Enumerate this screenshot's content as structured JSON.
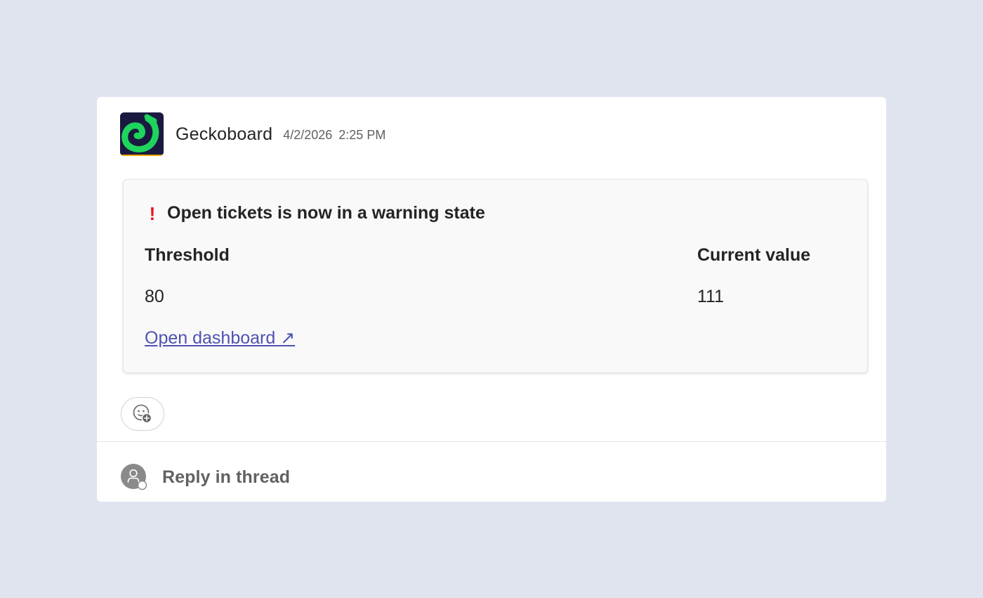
{
  "message": {
    "sender": "Geckoboard",
    "date": "4/2/2026",
    "time": "2:25 PM",
    "logo_icon": "geckoboard-logo"
  },
  "alert": {
    "icon": "exclamation-icon",
    "title": "Open tickets is now in a warning state",
    "columns": [
      {
        "label": "Threshold",
        "value": "80"
      },
      {
        "label": "Current value",
        "value": "111"
      }
    ],
    "link_label": "Open dashboard ↗"
  },
  "reactions": {
    "add_reaction_icon": "add-reaction-icon"
  },
  "reply": {
    "label": "Reply in thread"
  },
  "colors": {
    "background": "#e0e4ef",
    "link": "#4f52b2",
    "warning": "#e81123",
    "logo_bg": "#1a1a40",
    "logo_green": "#1fd45c"
  }
}
